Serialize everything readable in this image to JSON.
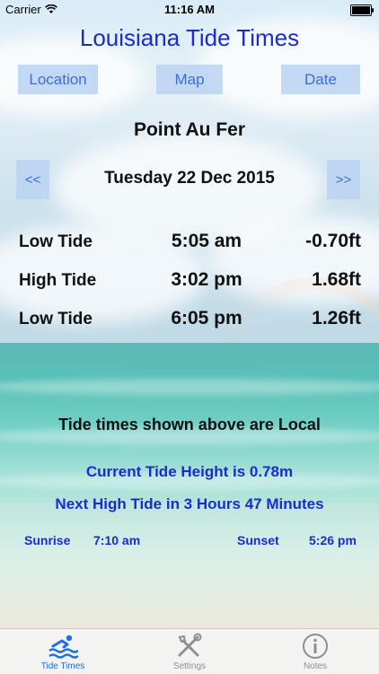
{
  "status_bar": {
    "carrier": "Carrier",
    "time": "11:16 AM"
  },
  "title": "Louisiana Tide Times",
  "buttons": {
    "location": "Location",
    "map": "Map",
    "date": "Date",
    "prev": "<<",
    "next": ">>"
  },
  "location_name": "Point Au Fer",
  "date": "Tuesday 22 Dec 2015",
  "tides": [
    {
      "type": "Low Tide",
      "time": "5:05 am",
      "height": "-0.70ft"
    },
    {
      "type": "High Tide",
      "time": "3:02 pm",
      "height": "1.68ft"
    },
    {
      "type": "Low Tide",
      "time": "6:05 pm",
      "height": "1.26ft"
    }
  ],
  "local_note": "Tide times shown above are Local",
  "current_height": "Current Tide Height is 0.78m",
  "next_high": "Next High Tide in 3 Hours 47 Minutes",
  "sun": {
    "sunrise_label": "Sunrise",
    "sunrise_time": "7:10 am",
    "sunset_label": "Sunset",
    "sunset_time": "5:26 pm"
  },
  "tabs": [
    {
      "label": "Tide Times",
      "icon": "swimmer-icon"
    },
    {
      "label": "Settings",
      "icon": "tools-icon"
    },
    {
      "label": "Notes",
      "icon": "info-icon"
    }
  ],
  "colors": {
    "accent_blue": "#1a2ccc",
    "button_bg": "#bdd4f2",
    "button_text": "#3a6fd8",
    "tab_active": "#1f6fe0"
  }
}
